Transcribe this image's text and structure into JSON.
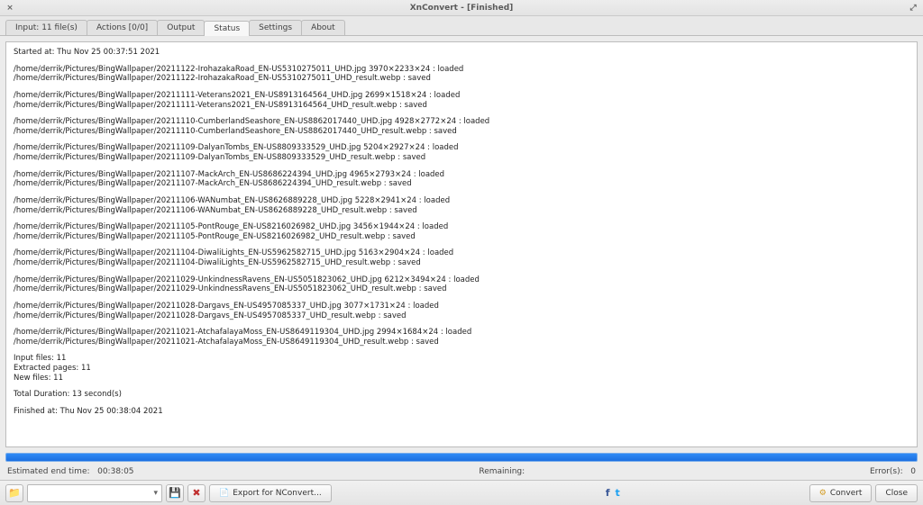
{
  "titlebar": {
    "title": "XnConvert - [Finished]"
  },
  "tabs": {
    "input": "Input: 11 file(s)",
    "actions": "Actions [0/0]",
    "output": "Output",
    "status": "Status",
    "settings": "Settings",
    "about": "About"
  },
  "log": {
    "started": "Started at: Thu Nov 25 00:37:51 2021",
    "entries": [
      {
        "loaded": "/home/derrik/Pictures/BingWallpaper/20211122-IrohazakaRoad_EN-US5310275011_UHD.jpg 3970×2233×24 : loaded",
        "saved": "/home/derrik/Pictures/BingWallpaper/20211122-IrohazakaRoad_EN-US5310275011_UHD_result.webp : saved"
      },
      {
        "loaded": "/home/derrik/Pictures/BingWallpaper/20211111-Veterans2021_EN-US8913164564_UHD.jpg 2699×1518×24 : loaded",
        "saved": "/home/derrik/Pictures/BingWallpaper/20211111-Veterans2021_EN-US8913164564_UHD_result.webp : saved"
      },
      {
        "loaded": "/home/derrik/Pictures/BingWallpaper/20211110-CumberlandSeashore_EN-US8862017440_UHD.jpg 4928×2772×24 : loaded",
        "saved": "/home/derrik/Pictures/BingWallpaper/20211110-CumberlandSeashore_EN-US8862017440_UHD_result.webp : saved"
      },
      {
        "loaded": "/home/derrik/Pictures/BingWallpaper/20211109-DalyanTombs_EN-US8809333529_UHD.jpg 5204×2927×24 : loaded",
        "saved": "/home/derrik/Pictures/BingWallpaper/20211109-DalyanTombs_EN-US8809333529_UHD_result.webp : saved"
      },
      {
        "loaded": "/home/derrik/Pictures/BingWallpaper/20211107-MackArch_EN-US8686224394_UHD.jpg 4965×2793×24 : loaded",
        "saved": "/home/derrik/Pictures/BingWallpaper/20211107-MackArch_EN-US8686224394_UHD_result.webp : saved"
      },
      {
        "loaded": "/home/derrik/Pictures/BingWallpaper/20211106-WANumbat_EN-US8626889228_UHD.jpg 5228×2941×24 : loaded",
        "saved": "/home/derrik/Pictures/BingWallpaper/20211106-WANumbat_EN-US8626889228_UHD_result.webp : saved"
      },
      {
        "loaded": "/home/derrik/Pictures/BingWallpaper/20211105-PontRouge_EN-US8216026982_UHD.jpg 3456×1944×24 : loaded",
        "saved": "/home/derrik/Pictures/BingWallpaper/20211105-PontRouge_EN-US8216026982_UHD_result.webp : saved"
      },
      {
        "loaded": "/home/derrik/Pictures/BingWallpaper/20211104-DiwaliLights_EN-US5962582715_UHD.jpg 5163×2904×24 : loaded",
        "saved": "/home/derrik/Pictures/BingWallpaper/20211104-DiwaliLights_EN-US5962582715_UHD_result.webp : saved"
      },
      {
        "loaded": "/home/derrik/Pictures/BingWallpaper/20211029-UnkindnessRavens_EN-US5051823062_UHD.jpg 6212×3494×24 : loaded",
        "saved": "/home/derrik/Pictures/BingWallpaper/20211029-UnkindnessRavens_EN-US5051823062_UHD_result.webp : saved"
      },
      {
        "loaded": "/home/derrik/Pictures/BingWallpaper/20211028-Dargavs_EN-US4957085337_UHD.jpg 3077×1731×24 : loaded",
        "saved": "/home/derrik/Pictures/BingWallpaper/20211028-Dargavs_EN-US4957085337_UHD_result.webp : saved"
      },
      {
        "loaded": "/home/derrik/Pictures/BingWallpaper/20211021-AtchafalayaMoss_EN-US8649119304_UHD.jpg 2994×1684×24 : loaded",
        "saved": "/home/derrik/Pictures/BingWallpaper/20211021-AtchafalayaMoss_EN-US8649119304_UHD_result.webp : saved"
      }
    ],
    "summary": {
      "input_files": "Input files: 11",
      "extracted": "Extracted pages: 11",
      "new_files": "New files: 11"
    },
    "duration": "Total Duration: 13 second(s)",
    "finished": "Finished at: Thu Nov 25 00:38:04 2021"
  },
  "footer": {
    "estimated_label": "Estimated end time:",
    "estimated_value": "00:38:05",
    "remaining_label": "Remaining:",
    "errors_label": "Error(s):",
    "errors_value": "0"
  },
  "toolbar": {
    "export_label": "Export for NConvert...",
    "convert_label": "Convert",
    "close_label": "Close"
  }
}
